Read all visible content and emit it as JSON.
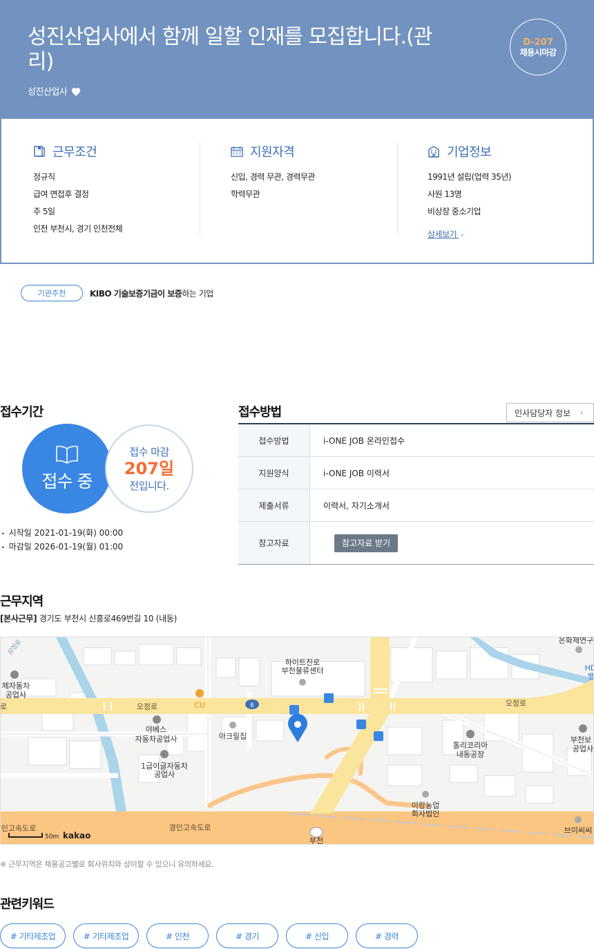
{
  "header": {
    "title": "성진산업사에서 함께 일할 인재를 모집합니다.(관리)",
    "company": "성진산업사",
    "dday": "D-207",
    "deadline_type": "채용시마감"
  },
  "summary": {
    "work": {
      "title": "근무조건",
      "lines": [
        "정규직",
        "급여 면접후 결정",
        "주 5일",
        "인천 부천시, 경기 인천전체"
      ]
    },
    "qualification": {
      "title": "지원자격",
      "lines": [
        "신입, 경력 무관, 경력무관",
        "학력무관"
      ]
    },
    "company": {
      "title": "기업정보",
      "lines": [
        "1991년 설립(업력 35년)",
        "사원 13명",
        "비상장 중소기업"
      ],
      "detail_link": "상세보기"
    }
  },
  "recommend": {
    "badge": "기관추천",
    "bold": "KIBO 기술보증기금이 보증",
    "rest": "하는 기업"
  },
  "period": {
    "title": "접수기간",
    "status": "접수 중",
    "side_top": "접수 마감",
    "side_days": "207일",
    "side_bottom": "전입니다.",
    "start": "시작일 2021-01-19(화) 00:00",
    "end": "마감일 2026-01-19(월) 01:00"
  },
  "method": {
    "title": "접수방법",
    "hr_button": "인사담당자 정보",
    "rows": [
      {
        "key": "접수방법",
        "value": "i-ONE JOB 온라인접수"
      },
      {
        "key": "지원양식",
        "value": "i-ONE JOB 이력서"
      },
      {
        "key": "제출서류",
        "value": "이력서, 자기소개서"
      },
      {
        "key": "참고자료",
        "button": "참고자료 받기"
      }
    ]
  },
  "location": {
    "title": "근무지역",
    "addr_tag": "[본사근무]",
    "addr": " 경기도 부천시 신흥로469번길 10 (내동)",
    "note": "※ 근무지역은 채용공고별로 회사위치와 상이할 수 있으니 유의하세요.",
    "map_labels": {
      "l1a": "하이트진로",
      "l1b": "부천물류센터",
      "l2": "오정로",
      "l3": "오정로",
      "l4": "로",
      "l5": "CU",
      "l6": "6",
      "l7a": "야베스",
      "l7b": "자동차공업사",
      "l8": "아크릴집",
      "l9a": "1급이글자동차",
      "l9b": "공업사",
      "l10a": "톨리코리아",
      "l10b": "내동공장",
      "l11a": "이랑농업",
      "l11b": "회사법인",
      "l12": "경인고속도로",
      "l13": "인고속도로",
      "l14a": "제자동차",
      "l14b": "공업사",
      "l15a": "부천보",
      "l15b": "공업사",
      "l16": "온화제연구",
      "l17": "브이씨씨",
      "l18": "부천",
      "l19": "HD",
      "l20": "뱅",
      "l21": "삼정로",
      "scale": "50m",
      "brand": "kakao"
    }
  },
  "keywords": {
    "title": "관련키워드",
    "items": [
      "# 기타제조업",
      "# 기타제조업",
      "# 인천",
      "# 경기",
      "# 신입",
      "# 경력"
    ]
  },
  "colors": {
    "header_bg": "#7293c0",
    "accent_blue": "#3a86e3",
    "accent_orange": "#f26b33",
    "dday_orange": "#f7b064"
  }
}
